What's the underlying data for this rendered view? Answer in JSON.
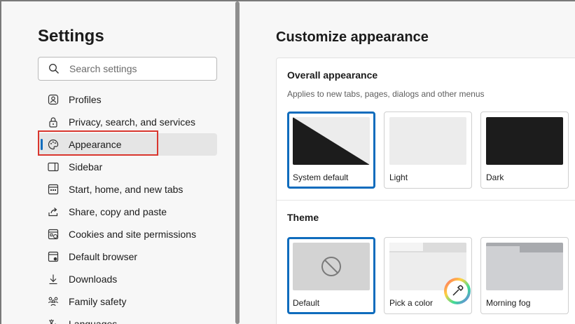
{
  "sidebar": {
    "title": "Settings",
    "search_placeholder": "Search settings",
    "items": [
      {
        "label": "Profiles",
        "icon": "profile-icon"
      },
      {
        "label": "Privacy, search, and services",
        "icon": "lock-icon"
      },
      {
        "label": "Appearance",
        "icon": "palette-icon",
        "active": true
      },
      {
        "label": "Sidebar",
        "icon": "sidebar-icon"
      },
      {
        "label": "Start, home, and new tabs",
        "icon": "home-grid-icon"
      },
      {
        "label": "Share, copy and paste",
        "icon": "share-icon"
      },
      {
        "label": "Cookies and site permissions",
        "icon": "cookie-icon"
      },
      {
        "label": "Default browser",
        "icon": "browser-icon"
      },
      {
        "label": "Downloads",
        "icon": "download-icon"
      },
      {
        "label": "Family safety",
        "icon": "family-icon"
      },
      {
        "label": "Languages",
        "icon": "language-icon"
      }
    ]
  },
  "main": {
    "title": "Customize appearance",
    "overall": {
      "title": "Overall appearance",
      "description": "Applies to new tabs, pages, dialogs and other menus",
      "options": [
        {
          "label": "System default",
          "selected": true
        },
        {
          "label": "Light",
          "selected": false
        },
        {
          "label": "Dark",
          "selected": false
        }
      ]
    },
    "theme": {
      "title": "Theme",
      "options": [
        {
          "label": "Default",
          "selected": true
        },
        {
          "label": "Pick a color",
          "selected": false
        },
        {
          "label": "Morning fog",
          "selected": false
        }
      ]
    }
  },
  "colors": {
    "accent": "#0f6cbd",
    "highlight": "#d9362e"
  }
}
